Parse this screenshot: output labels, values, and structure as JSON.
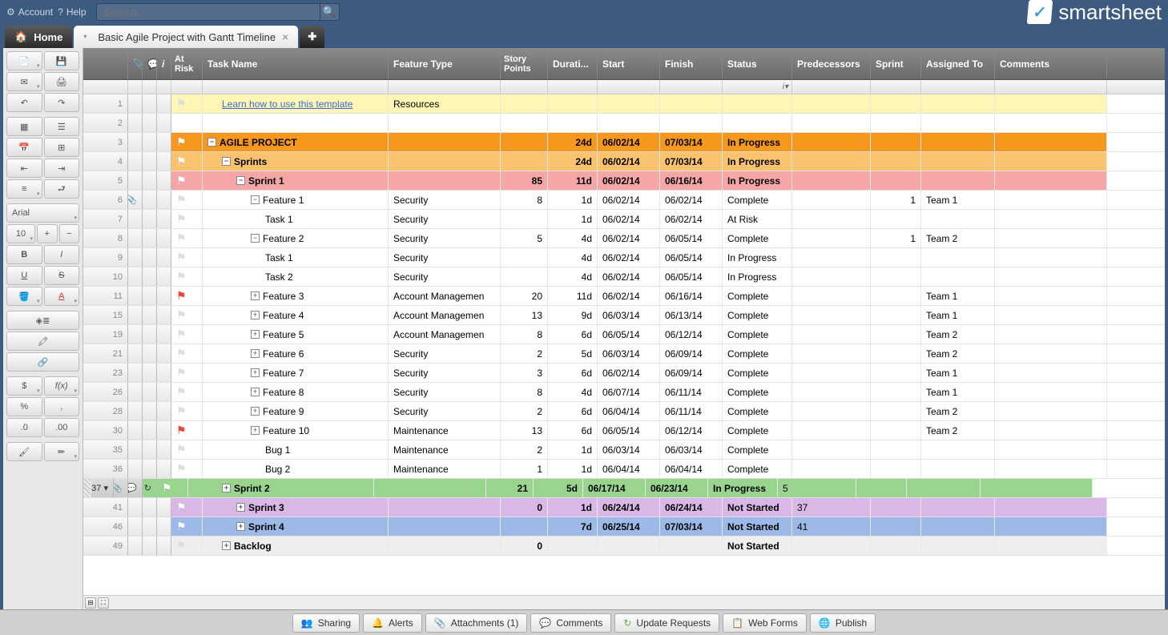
{
  "topbar": {
    "account": "Account",
    "help": "Help",
    "search_placeholder": "Search..."
  },
  "logo": "smartsheet",
  "tabs": {
    "home": "Home",
    "sheet": "Basic Agile Project with Gantt Timeline"
  },
  "toolbar": {
    "font": "Arial",
    "size": "10"
  },
  "columns": [
    "",
    "",
    "",
    "",
    "At Risk",
    "Task Name",
    "Feature Type",
    "Story Points",
    "Durati...",
    "Start",
    "Finish",
    "Status",
    "Predecessors",
    "Sprint",
    "Assigned To",
    "Comments"
  ],
  "subheader_status": "i",
  "rows": [
    {
      "n": "1",
      "bg": "#fdf6b5",
      "flag": "grey",
      "task": "Learn how to use this template",
      "link": true,
      "indent": 1,
      "ft": "Resources"
    },
    {
      "n": "2",
      "bg": "#ffffff"
    },
    {
      "n": "3",
      "bg": "#f5981c",
      "flag": "white",
      "bold": true,
      "exp": "-",
      "indent": 0,
      "task": "AGILE PROJECT",
      "dur": "24d",
      "start": "06/02/14",
      "fin": "07/03/14",
      "status": "In Progress"
    },
    {
      "n": "4",
      "bg": "#fbc36e",
      "flag": "white",
      "bold": true,
      "exp": "-",
      "indent": 1,
      "task": "Sprints",
      "dur": "24d",
      "start": "06/02/14",
      "fin": "07/03/14",
      "status": "In Progress"
    },
    {
      "n": "5",
      "bg": "#f6a6a6",
      "flag": "white",
      "bold": true,
      "exp": "-",
      "indent": 2,
      "task": "Sprint 1",
      "sp": "85",
      "dur": "11d",
      "start": "06/02/14",
      "fin": "06/16/14",
      "status": "In Progress"
    },
    {
      "n": "6",
      "bg": "#ffffff",
      "clip": true,
      "flag": "grey",
      "exp": "-",
      "indent": 3,
      "task": "Feature 1",
      "ft": "Security",
      "sp": "8",
      "dur": "1d",
      "start": "06/02/14",
      "fin": "06/02/14",
      "status": "Complete",
      "sprint": "1",
      "assigned": "Team 1"
    },
    {
      "n": "7",
      "bg": "#ffffff",
      "flag": "grey",
      "indent": 4,
      "task": "Task 1",
      "ft": "Security",
      "dur": "1d",
      "start": "06/02/14",
      "fin": "06/02/14",
      "status": "At Risk"
    },
    {
      "n": "8",
      "bg": "#ffffff",
      "flag": "grey",
      "exp": "-",
      "indent": 3,
      "task": "Feature 2",
      "ft": "Security",
      "sp": "5",
      "dur": "4d",
      "start": "06/02/14",
      "fin": "06/05/14",
      "status": "Complete",
      "sprint": "1",
      "assigned": "Team 2"
    },
    {
      "n": "9",
      "bg": "#ffffff",
      "flag": "grey",
      "indent": 4,
      "task": "Task 1",
      "ft": "Security",
      "dur": "4d",
      "start": "06/02/14",
      "fin": "06/05/14",
      "status": "In Progress"
    },
    {
      "n": "10",
      "bg": "#ffffff",
      "flag": "grey",
      "indent": 4,
      "task": "Task 2",
      "ft": "Security",
      "dur": "4d",
      "start": "06/02/14",
      "fin": "06/05/14",
      "status": "In Progress"
    },
    {
      "n": "11",
      "bg": "#ffffff",
      "flag": "red",
      "exp": "+",
      "indent": 3,
      "task": "Feature 3",
      "ft": "Account Managemen",
      "sp": "20",
      "dur": "11d",
      "start": "06/02/14",
      "fin": "06/16/14",
      "status": "Complete",
      "assigned": "Team 1"
    },
    {
      "n": "15",
      "bg": "#ffffff",
      "flag": "grey",
      "exp": "+",
      "indent": 3,
      "task": "Feature 4",
      "ft": "Account Managemen",
      "sp": "13",
      "dur": "9d",
      "start": "06/03/14",
      "fin": "06/13/14",
      "status": "Complete",
      "assigned": "Team 1"
    },
    {
      "n": "19",
      "bg": "#ffffff",
      "flag": "grey",
      "exp": "+",
      "indent": 3,
      "task": "Feature 5",
      "ft": "Account Managemen",
      "sp": "8",
      "dur": "6d",
      "start": "06/05/14",
      "fin": "06/12/14",
      "status": "Complete",
      "assigned": "Team 2"
    },
    {
      "n": "21",
      "bg": "#ffffff",
      "flag": "grey",
      "exp": "+",
      "indent": 3,
      "task": "Feature 6",
      "ft": "Security",
      "sp": "2",
      "dur": "5d",
      "start": "06/03/14",
      "fin": "06/09/14",
      "status": "Complete",
      "assigned": "Team 2"
    },
    {
      "n": "23",
      "bg": "#ffffff",
      "flag": "grey",
      "exp": "+",
      "indent": 3,
      "task": "Feature 7",
      "ft": "Security",
      "sp": "3",
      "dur": "6d",
      "start": "06/02/14",
      "fin": "06/09/14",
      "status": "Complete",
      "assigned": "Team 1"
    },
    {
      "n": "26",
      "bg": "#ffffff",
      "flag": "grey",
      "exp": "+",
      "indent": 3,
      "task": "Feature 8",
      "ft": "Security",
      "sp": "8",
      "dur": "4d",
      "start": "06/07/14",
      "fin": "06/11/14",
      "status": "Complete",
      "assigned": "Team 1"
    },
    {
      "n": "28",
      "bg": "#ffffff",
      "flag": "grey",
      "exp": "+",
      "indent": 3,
      "task": "Feature 9",
      "ft": "Security",
      "sp": "2",
      "dur": "6d",
      "start": "06/04/14",
      "fin": "06/11/14",
      "status": "Complete",
      "assigned": "Team 2"
    },
    {
      "n": "30",
      "bg": "#ffffff",
      "flag": "red",
      "exp": "+",
      "indent": 3,
      "task": "Feature 10",
      "ft": "Maintenance",
      "sp": "13",
      "dur": "6d",
      "start": "06/05/14",
      "fin": "06/12/14",
      "status": "Complete",
      "assigned": "Team 2"
    },
    {
      "n": "35",
      "bg": "#ffffff",
      "flag": "grey",
      "indent": 4,
      "task": "Bug 1",
      "ft": "Maintenance",
      "sp": "2",
      "dur": "1d",
      "start": "06/03/14",
      "fin": "06/03/14",
      "status": "Complete"
    },
    {
      "n": "36",
      "bg": "#ffffff",
      "flag": "grey",
      "indent": 4,
      "task": "Bug 2",
      "ft": "Maintenance",
      "sp": "1",
      "dur": "1d",
      "start": "06/04/14",
      "fin": "06/04/14",
      "status": "Complete"
    },
    {
      "n": "37",
      "bg": "#9ad58f",
      "sel": true,
      "flag": "white",
      "bold": true,
      "exp": "+",
      "indent": 2,
      "task": "Sprint 2",
      "sp": "21",
      "dur": "5d",
      "start": "06/17/14",
      "fin": "06/23/14",
      "status": "In Progress",
      "pred": "5"
    },
    {
      "n": "41",
      "bg": "#d9b8e8",
      "flag": "white",
      "bold": true,
      "exp": "+",
      "indent": 2,
      "task": "Sprint 3",
      "sp": "0",
      "dur": "1d",
      "start": "06/24/14",
      "fin": "06/24/14",
      "status": "Not Started",
      "pred": "37"
    },
    {
      "n": "46",
      "bg": "#9db9e8",
      "flag": "white",
      "bold": true,
      "exp": "+",
      "indent": 2,
      "task": "Sprint 4",
      "dur": "7d",
      "start": "06/25/14",
      "fin": "07/03/14",
      "status": "Not Started",
      "pred": "41"
    },
    {
      "n": "49",
      "bg": "#eeeeee",
      "flag": "grey",
      "bold": true,
      "exp": "+",
      "indent": 1,
      "task": "Backlog",
      "sp": "0",
      "status": "Not Started"
    }
  ],
  "footer": {
    "sharing": "Sharing",
    "alerts": "Alerts",
    "attachments": "Attachments (1)",
    "comments": "Comments",
    "update": "Update Requests",
    "forms": "Web Forms",
    "publish": "Publish"
  }
}
